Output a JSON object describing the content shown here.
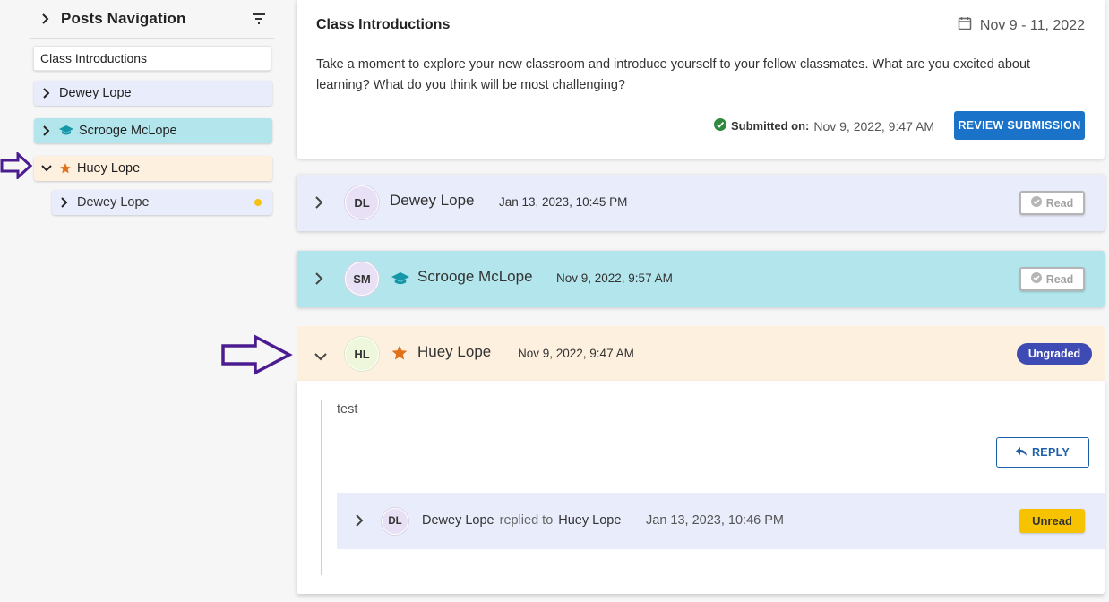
{
  "sidebar": {
    "title": "Posts Navigation",
    "items": {
      "class_intro": "Class Introductions",
      "dewey": "Dewey Lope",
      "scrooge": "Scrooge McLope",
      "huey": "Huey Lope",
      "huey_child": "Dewey Lope"
    }
  },
  "assignment": {
    "title": "Class Introductions",
    "date_range": "Nov 9 - 11, 2022",
    "prompt": "Take a moment to explore your new classroom and introduce yourself to your fellow classmates. What are you excited about learning? What do you think will be most challenging?",
    "submitted_label": "Submitted on:",
    "submitted_time": "Nov 9, 2022, 9:47 AM",
    "review_button": "REVIEW SUBMISSION"
  },
  "posts": [
    {
      "initials": "DL",
      "name": "Dewey Lope",
      "time": "Jan 13, 2023, 10:45 PM",
      "status": "Read"
    },
    {
      "initials": "SM",
      "name": "Scrooge McLope",
      "time": "Nov 9, 2022, 9:57 AM",
      "status": "Read"
    },
    {
      "initials": "HL",
      "name": "Huey Lope",
      "time": "Nov 9, 2022, 9:47 AM",
      "status": "Ungraded"
    }
  ],
  "expanded_post": {
    "body": "test",
    "reply_button": "REPLY",
    "reply": {
      "initials": "DL",
      "author": "Dewey Lope",
      "replied_to_label": "replied to",
      "target": "Huey Lope",
      "time": "Jan 13, 2023, 10:46 PM",
      "status": "Unread"
    }
  },
  "colors": {
    "accent_blue": "#1a73c9",
    "row_lavender": "#e9ecfb",
    "row_teal": "#b2e5ec",
    "row_peach": "#fdf0de",
    "badge_ungraded": "#3f4bb5",
    "badge_unread": "#f7c300",
    "annotation_arrow": "#4b1c8f"
  },
  "icons": {
    "filter": "filter-icon",
    "calendar": "calendar-icon",
    "check": "check-circle-icon",
    "instructor": "graduation-cap-icon",
    "star": "star-icon",
    "reply": "reply-icon"
  }
}
